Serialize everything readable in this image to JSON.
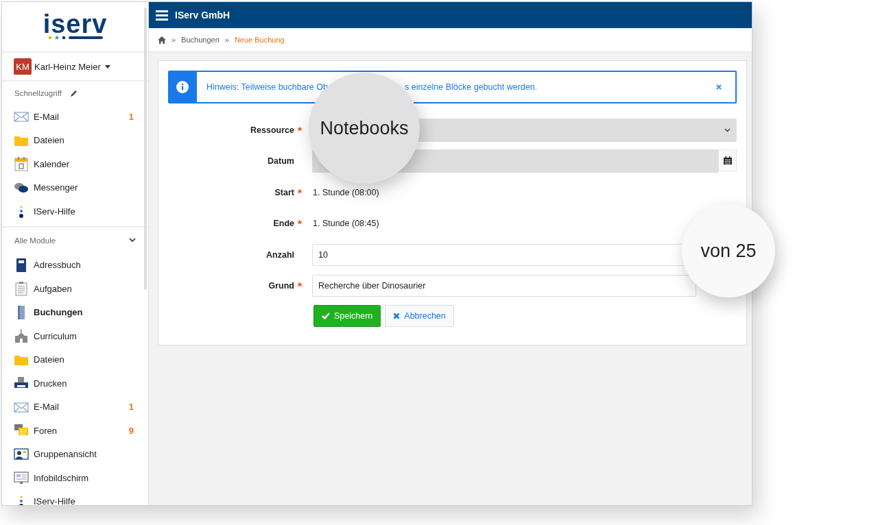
{
  "sidebar": {
    "logo": "iserv",
    "user": {
      "initials": "KM",
      "name": "Karl-Heinz Meier"
    },
    "quick_access": {
      "title": "Schnellzugriff",
      "items": [
        {
          "kind": "mail",
          "label": "E-Mail",
          "badge": "1",
          "selected": false
        },
        {
          "kind": "folder",
          "label": "Dateien",
          "selected": false
        },
        {
          "kind": "calendar",
          "label": "Kalender",
          "selected": false
        },
        {
          "kind": "chat",
          "label": "Messenger",
          "selected": false
        },
        {
          "kind": "help",
          "label": "IServ-Hilfe",
          "selected": false
        }
      ]
    },
    "all_modules": {
      "title": "Alle Module",
      "expanded": true,
      "items": [
        {
          "kind": "book",
          "label": "Adressbuch",
          "selected": false
        },
        {
          "kind": "clipboard",
          "label": "Aufgaben",
          "selected": false
        },
        {
          "kind": "door",
          "label": "Buchungen",
          "selected": true
        },
        {
          "kind": "school",
          "label": "Curriculum",
          "selected": false
        },
        {
          "kind": "folder",
          "label": "Dateien",
          "selected": false
        },
        {
          "kind": "printer",
          "label": "Drucken",
          "selected": false
        },
        {
          "kind": "mail",
          "label": "E-Mail",
          "badge": "1",
          "selected": false
        },
        {
          "kind": "forum",
          "label": "Foren",
          "badge": "9",
          "selected": false
        },
        {
          "kind": "group",
          "label": "Gruppenansicht",
          "selected": false
        },
        {
          "kind": "screen",
          "label": "Infobildschirm",
          "selected": false
        },
        {
          "kind": "help",
          "label": "IServ-Hilfe",
          "selected": false
        }
      ]
    }
  },
  "topbar": {
    "title": "IServ GmbH"
  },
  "breadcrumb": [
    {
      "kind": "home"
    },
    {
      "kind": "separator",
      "text": "»"
    },
    {
      "kind": "link",
      "text": "Buchungen",
      "current": false
    },
    {
      "kind": "separator",
      "text": "»"
    },
    {
      "kind": "link",
      "text": "Neue Buchung",
      "current": true
    }
  ],
  "alert": {
    "text_before": "Hinweis: Teilweise buchbare Ob",
    "text_after": "s einzelne Blöcke gebucht werden."
  },
  "form": {
    "rows": [
      {
        "kind": "select",
        "label": "Ressource",
        "required": true,
        "disabled": true
      },
      {
        "kind": "date",
        "label": "Datum",
        "required": false,
        "disabled": true
      },
      {
        "kind": "static",
        "label": "Start",
        "required": true,
        "value": "1. Stunde (08:00)"
      },
      {
        "kind": "static",
        "label": "Ende",
        "required": true,
        "value": "1. Stunde (08:45)"
      },
      {
        "kind": "input",
        "label": "Anzahl",
        "required": false,
        "disabled": false,
        "value": "10"
      },
      {
        "kind": "input",
        "label": "Grund",
        "required": true,
        "disabled": false,
        "value": "Recherche über Dinosaurier"
      }
    ],
    "buttons": [
      {
        "kind": "save",
        "label": "Speichern"
      },
      {
        "kind": "cancel",
        "label": "Abbrechen"
      }
    ]
  },
  "magnifiers": [
    {
      "kind": "dark",
      "text": "Notebooks"
    },
    {
      "kind": "light",
      "text": "von 25"
    }
  ]
}
